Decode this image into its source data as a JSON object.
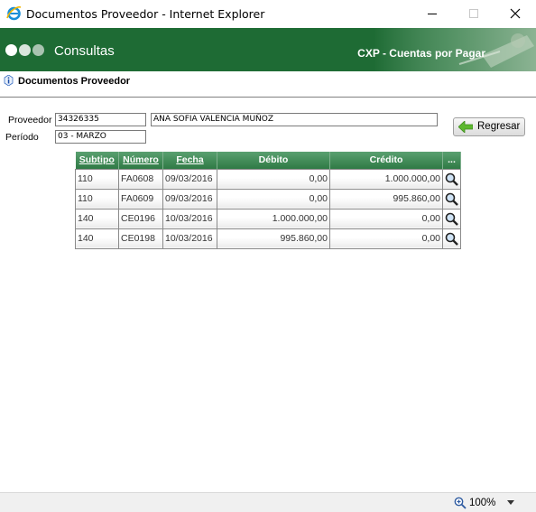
{
  "window": {
    "title": "Documentos Proveedor - Internet Explorer"
  },
  "banner": {
    "app_title": "Consultas",
    "module": "CXP - Cuentas por Pagar"
  },
  "page": {
    "title": "Documentos Proveedor"
  },
  "form": {
    "proveedor_label": "Proveedor",
    "proveedor_code": "34326335",
    "proveedor_name": "ANA SOFIA VALENCIA MUÑOZ",
    "periodo_label": "Período",
    "periodo_value": "03 - MARZO",
    "regresar_label": "Regresar"
  },
  "table": {
    "headers": [
      "Subtipo",
      "Número",
      "Fecha",
      "Débito",
      "Crédito",
      "..."
    ],
    "rows": [
      [
        "110",
        "FA0608",
        "09/03/2016",
        "0,00",
        "1.000.000,00"
      ],
      [
        "110",
        "FA0609",
        "09/03/2016",
        "0,00",
        "995.860,00"
      ],
      [
        "140",
        "CE0196",
        "10/03/2016",
        "1.000.000,00",
        "0,00"
      ],
      [
        "140",
        "CE0198",
        "10/03/2016",
        "995.860,00",
        "0,00"
      ]
    ]
  },
  "status": {
    "zoom": "100%"
  },
  "colors": {
    "banner": "#1e6b34",
    "table_header": "#3f8a55"
  }
}
